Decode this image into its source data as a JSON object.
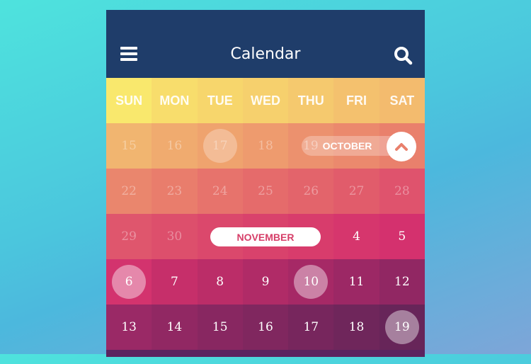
{
  "header": {
    "title": "Calendar",
    "menu_icon": "hamburger-menu-icon",
    "search_icon": "search-icon",
    "background": "#1f3d6a"
  },
  "weekdays": [
    "SUN",
    "MON",
    "TUE",
    "WED",
    "THU",
    "FRI",
    "SAT"
  ],
  "months": {
    "current_label": "OCTOBER",
    "next_label": "NOVEMBER",
    "collapse_icon": "chevron-up-icon"
  },
  "weeks": [
    {
      "days": [
        "15",
        "16",
        "17",
        "18",
        "19",
        "",
        ""
      ],
      "dim": true
    },
    {
      "days": [
        "22",
        "23",
        "24",
        "25",
        "26",
        "27",
        "28"
      ],
      "dim": true
    },
    {
      "days": [
        "29",
        "30",
        "",
        "",
        "",
        "4",
        "5"
      ],
      "dim_indices": [
        0,
        1
      ]
    },
    {
      "days": [
        "6",
        "7",
        "8",
        "9",
        "10",
        "11",
        "12"
      ]
    },
    {
      "days": [
        "13",
        "14",
        "15",
        "16",
        "17",
        "18",
        "19"
      ]
    }
  ],
  "highlighted_days": [
    {
      "month": "OCTOBER",
      "day": "17"
    },
    {
      "month": "NOVEMBER",
      "day": "6"
    },
    {
      "month": "NOVEMBER",
      "day": "10"
    },
    {
      "month": "NOVEMBER",
      "day": "19"
    }
  ],
  "colors": {
    "accent_pink": "#d63e68",
    "weekday_row": [
      "#f9e86d",
      "#f8dd6c",
      "#f7d66c",
      "#f6d06d",
      "#f5c96e",
      "#f4c16e",
      "#f3bb6e"
    ],
    "row_colors": [
      [
        "#f1b570",
        "#f0ab6f",
        "#efa36e",
        "#ee9b6e",
        "#ec916e",
        "#eb896d",
        "#e9806c"
      ],
      [
        "#ea866d",
        "#e97d6c",
        "#e7736c",
        "#e56b6b",
        "#e3646b",
        "#e15c6b",
        "#df536d"
      ],
      [
        "#df566d",
        "#dd4f6c",
        "#db486c",
        "#d9426c",
        "#d83c6c",
        "#d6366d",
        "#d4316e"
      ],
      [
        "#d3336e",
        "#c62f6a",
        "#bb2d68",
        "#b02b67",
        "#a62966",
        "#9c2865",
        "#912763"
      ],
      [
        "#9a2966",
        "#912863",
        "#882761",
        "#80275f",
        "#77265d",
        "#6f265b",
        "#672559"
      ]
    ],
    "bottom_row": "#5b2460"
  }
}
